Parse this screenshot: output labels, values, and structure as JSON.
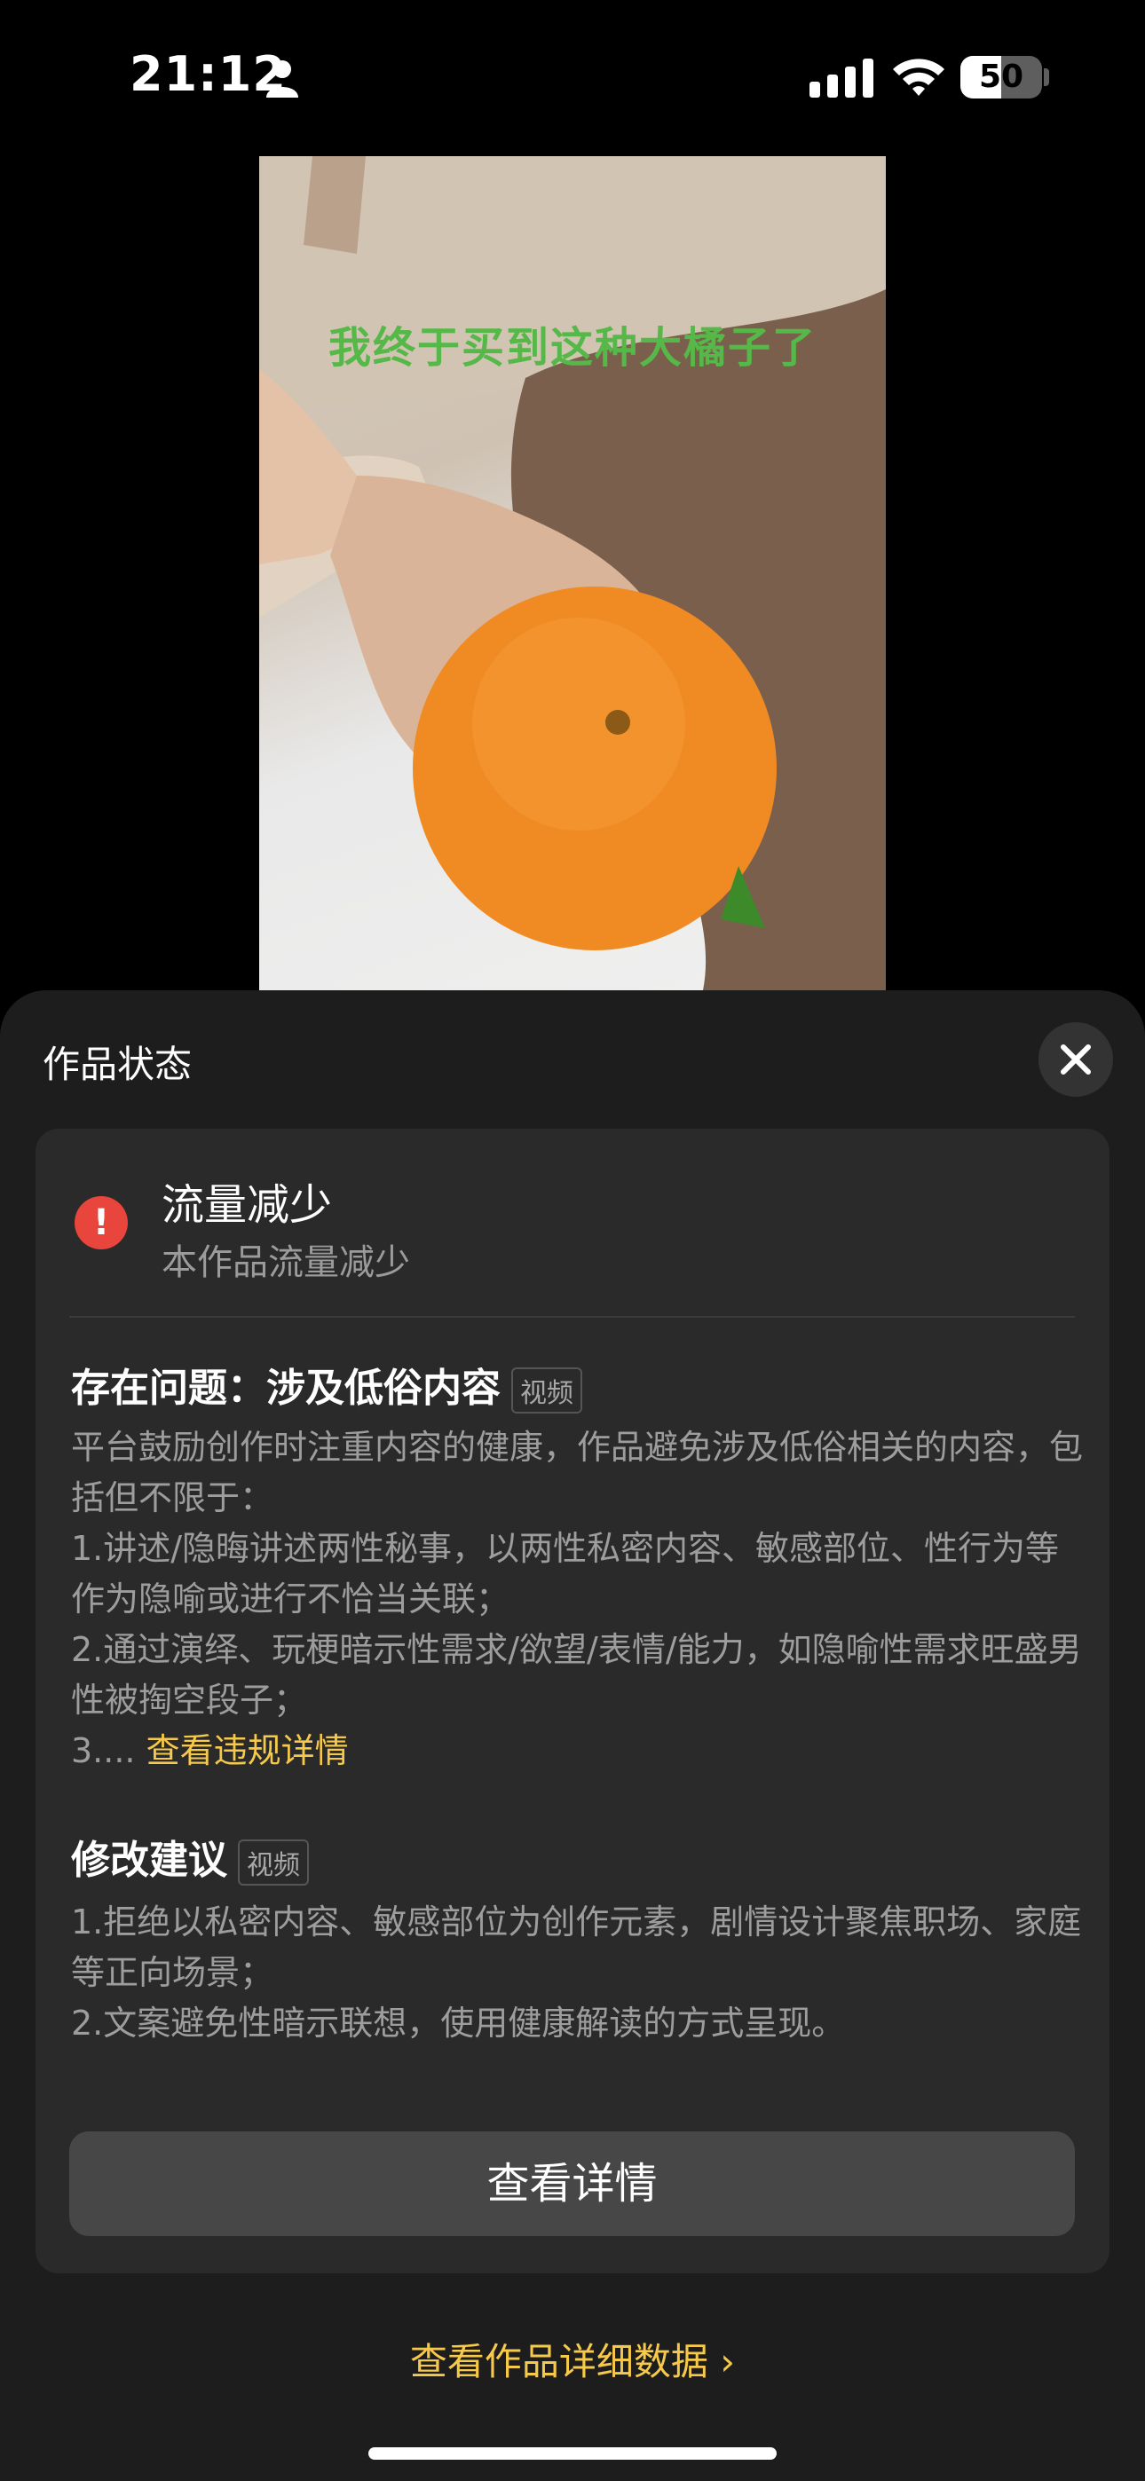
{
  "status_bar": {
    "time": "21:12",
    "battery": "50",
    "battery_level": 0.5
  },
  "video": {
    "caption": "我终于买到这种大橘子了"
  },
  "sheet": {
    "title": "作品状态",
    "status": {
      "title": "流量减少",
      "subtitle": "本作品流量减少"
    },
    "problem": {
      "title": "存在问题：涉及低俗内容",
      "tag": "视频",
      "lines": [
        "平台鼓励创作时注重内容的健康，作品避免涉及低俗相关的内容，包括但不限于：",
        "1.讲述/隐晦讲述两性秘事，以两性私密内容、敏感部位、性行为等作为隐喻或进行不恰当关联；",
        "2.通过演绎、玩梗暗示性需求/欲望/表情/能力，如隐喻性需求旺盛男性被掏空段子；"
      ],
      "ellipsis": "3.... ",
      "link": "查看违规详情"
    },
    "suggestion": {
      "title": "修改建议",
      "tag": "视频",
      "lines": [
        "1.拒绝以私密内容、敏感部位为创作元素，剧情设计聚焦职场、家庭等正向场景；",
        "2.文案避免性暗示联想，使用健康解读的方式呈现。"
      ]
    },
    "detail_button": "查看详情",
    "data_link": "查看作品详细数据 ›"
  },
  "colors": {
    "accent": "#f6c94a",
    "alert": "#e8453c",
    "caption": "#56b848"
  }
}
